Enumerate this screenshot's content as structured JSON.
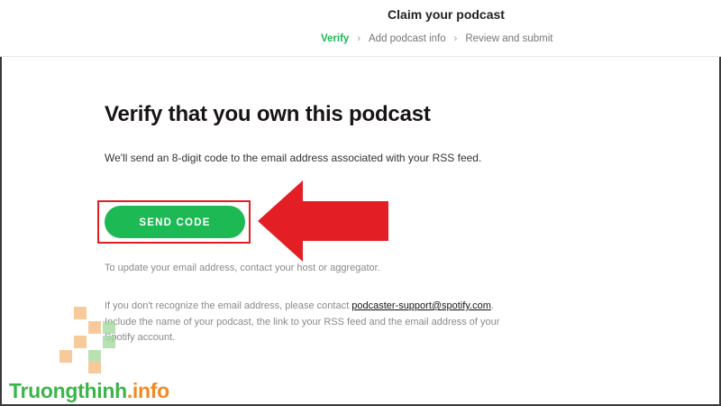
{
  "header": {
    "title": "Claim your podcast",
    "steps": [
      {
        "label": "Verify",
        "active": true
      },
      {
        "label": "Add podcast info",
        "active": false
      },
      {
        "label": "Review and submit",
        "active": false
      }
    ],
    "separator": "›"
  },
  "main": {
    "heading": "Verify that you own this podcast",
    "description": "We'll send an 8-digit code to the email address associated with your RSS feed.",
    "send_button_label": "SEND CODE",
    "note_update": "To update your email address, contact your host or aggregator.",
    "note_recognize_prefix": "If you don't recognize the email address, please contact ",
    "note_recognize_link": "podcaster-support@spotify.com",
    "note_recognize_suffix": ". Include the name of your podcast, the link to your RSS feed and the email address of your Spotify account."
  },
  "annotation": {
    "arrow_color": "#e31e24",
    "highlight_color": "#e31e24"
  },
  "watermark": {
    "name": "Truongthinh",
    "suffix": ".info"
  },
  "colors": {
    "accent": "#1db954",
    "text": "#191414",
    "muted": "#8a8a8a"
  }
}
